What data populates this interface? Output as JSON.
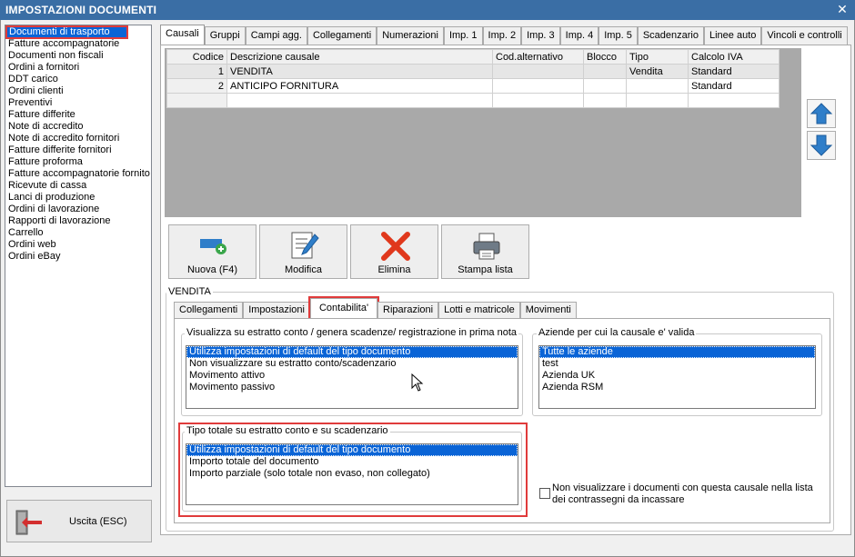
{
  "window": {
    "title": "IMPOSTAZIONI DOCUMENTI",
    "close_glyph": "✕"
  },
  "doc_types": [
    "Documenti di trasporto",
    "Fatture accompagnatorie",
    "Documenti non fiscali",
    "Ordini a fornitori",
    "DDT carico",
    "Ordini clienti",
    "Preventivi",
    "Fatture differite",
    "Note di accredito",
    "Note di accredito fornitori",
    "Fatture differite fornitori",
    "Fatture proforma",
    "Fatture accompagnatorie fornito",
    "Ricevute di cassa",
    "Lanci di produzione",
    "Ordini di lavorazione",
    "Rapporti di lavorazione",
    "Carrello",
    "Ordini web",
    "Ordini eBay"
  ],
  "exit_button": {
    "label": "Uscita (ESC)",
    "icon": "exit-door-icon"
  },
  "top_tabs": [
    "Causali",
    "Gruppi",
    "Campi agg.",
    "Collegamenti",
    "Numerazioni",
    "Imp. 1",
    "Imp. 2",
    "Imp. 3",
    "Imp. 4",
    "Imp. 5",
    "Scadenzario",
    "Linee auto",
    "Vincoli e controlli"
  ],
  "grid": {
    "columns": [
      "Codice",
      "Descrizione causale",
      "Cod.alternativo",
      "Blocco",
      "Tipo",
      "Calcolo IVA"
    ],
    "rows": [
      [
        "1",
        "VENDITA",
        "",
        "",
        "Vendita",
        "Standard"
      ],
      [
        "2",
        "ANTICIPO FORNITURA",
        "",
        "",
        "",
        "Standard"
      ],
      [
        "",
        "",
        "",
        "",
        "",
        ""
      ]
    ]
  },
  "actions": [
    {
      "label": "Nuova (F4)",
      "icon": "add-new-icon"
    },
    {
      "label": "Modifica",
      "icon": "edit-document-icon"
    },
    {
      "label": "Elimina",
      "icon": "delete-x-icon"
    },
    {
      "label": "Stampa lista",
      "icon": "printer-icon"
    }
  ],
  "group_title": "VENDITA",
  "sub_tabs": [
    "Collegamenti",
    "Impostazioni",
    "Contabilita'",
    "Riparazioni",
    "Lotti e matricole",
    "Movimenti"
  ],
  "estratto": {
    "title": "Visualizza su estratto conto / genera scadenze/ registrazione  in prima nota",
    "options": [
      "Utilizza impostazioni di default del tipo documento",
      "Non visualizzare su estratto conto/scadenzario",
      "Movimento attivo",
      "Movimento passivo"
    ]
  },
  "aziende": {
    "title": "Aziende per cui la causale e' valida",
    "options": [
      "Tutte le aziende",
      "test",
      "Azienda UK",
      "Azienda RSM"
    ]
  },
  "tipo_totale": {
    "title": "Tipo totale su estratto conto e su scadenzario",
    "options": [
      "Utilizza impostazioni di default del tipo documento",
      "Importo totale del documento",
      "Importo parziale (solo totale non evaso, non collegato)"
    ]
  },
  "checkbox_label": "Non visualizzare i documenti con questa causale nella lista dei contrassegni da incassare",
  "colors": {
    "titlebar": "#3a6ea5",
    "selection": "#0a64d6",
    "highlight": "#e03b3b"
  }
}
